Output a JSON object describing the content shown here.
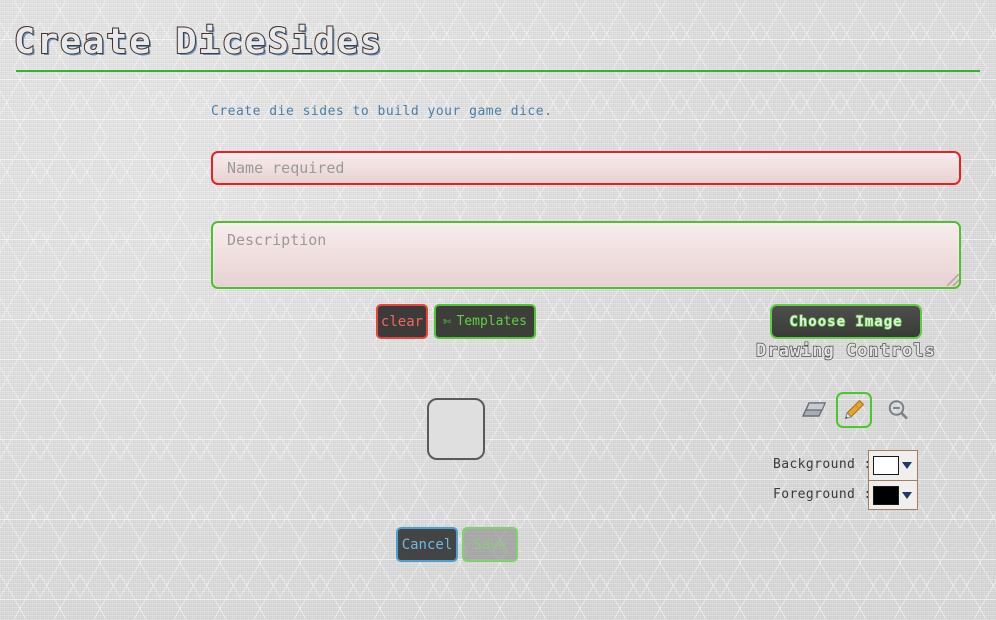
{
  "header": {
    "title": "Create DiceSides"
  },
  "form": {
    "subtitle": "Create die sides to build your game dice.",
    "name_value": "",
    "name_placeholder": "Name required",
    "description_value": "",
    "description_placeholder": "Description"
  },
  "actions": {
    "clear_label": "clear",
    "templates_label": "Templates",
    "templates_icon": "scissors-icon",
    "templates_glyph": "✄",
    "choose_image_label": "Choose Image"
  },
  "drawing_controls": {
    "title": "Drawing Controls",
    "tools": [
      {
        "name": "eraser-tool",
        "label": "Eraser",
        "selected": false
      },
      {
        "name": "pencil-tool",
        "label": "Pencil",
        "selected": true
      },
      {
        "name": "zoom-out-tool",
        "label": "Zoom Out",
        "selected": false
      }
    ],
    "background_label": "Background :",
    "background_color": "#ffffff",
    "foreground_label": "Foreground :",
    "foreground_color": "#000000"
  },
  "canvas": {
    "name": "die-side-canvas",
    "fill_color": "#dfdfdf",
    "border_color": "#5a5a5a"
  },
  "footer": {
    "cancel_label": "Cancel",
    "save_label": "Save",
    "save_enabled": false
  },
  "theme": {
    "accent_green": "#4fc12e",
    "error_red": "#ef1f1f",
    "link_blue": "#4a7fa5",
    "cancel_blue": "#4d9fd4"
  }
}
